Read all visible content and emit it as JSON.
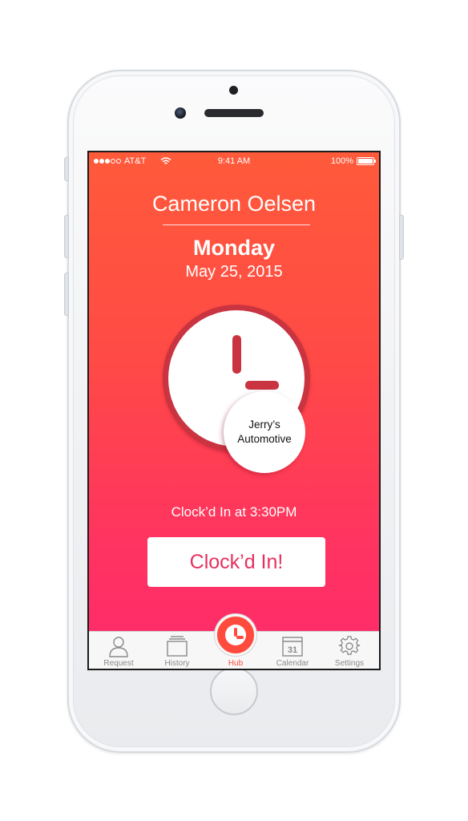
{
  "status_bar": {
    "carrier": "AT&T",
    "time": "9:41 AM",
    "battery": "100%",
    "signal_bars": 3,
    "signal_total": 5
  },
  "employee_name": "Cameron Oelsen",
  "day": "Monday",
  "date": "May 25, 2015",
  "business_name": "Jerry’s\nAutomotive",
  "clocked_status": "Clock’d In at 3:30PM",
  "clock_button_label": "Clock’d In!",
  "colors": {
    "gradient_top": "#ff5a3a",
    "gradient_bottom": "#ff2a6c",
    "accent": "#e8305e",
    "clock_ring": "#c93440",
    "tab_active": "#ff4a3e"
  },
  "tabs": [
    {
      "label": "Request",
      "icon": "person-icon",
      "active": false
    },
    {
      "label": "History",
      "icon": "folder-icon",
      "active": false
    },
    {
      "label": "Hub",
      "icon": "clock-icon",
      "active": true
    },
    {
      "label": "Calendar",
      "icon": "calendar-icon",
      "active": false,
      "icon_text": "31"
    },
    {
      "label": "Settings",
      "icon": "gear-icon",
      "active": false
    }
  ]
}
